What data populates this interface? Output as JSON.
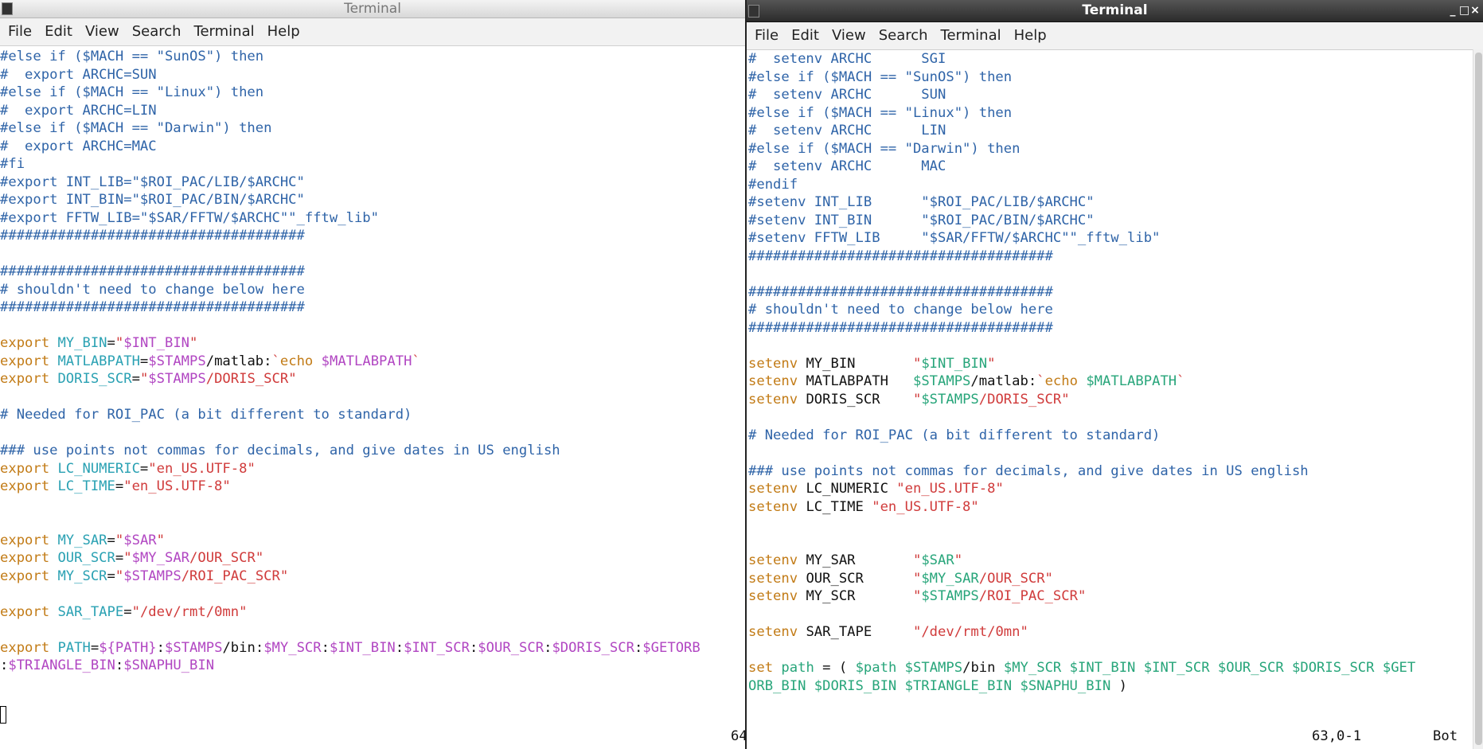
{
  "left": {
    "title": "Terminal",
    "menu": [
      "File",
      "Edit",
      "View",
      "Search",
      "Terminal",
      "Help"
    ],
    "status_right": "64"
  },
  "right": {
    "title": "Terminal",
    "menu": [
      "File",
      "Edit",
      "View",
      "Search",
      "Terminal",
      "Help"
    ],
    "status_pos": "63,0-1",
    "status_scroll": "Bot",
    "window_controls": [
      "minimize",
      "maximize",
      "close"
    ]
  },
  "left_lines": [
    [
      [
        "c",
        "#else if ($MACH == \"SunOS\") then"
      ]
    ],
    [
      [
        "c",
        "#  export ARCHC=SUN"
      ]
    ],
    [
      [
        "c",
        "#else if ($MACH == \"Linux\") then"
      ]
    ],
    [
      [
        "c",
        "#  export ARCHC=LIN"
      ]
    ],
    [
      [
        "c",
        "#else if ($MACH == \"Darwin\") then"
      ]
    ],
    [
      [
        "c",
        "#  export ARCHC=MAC"
      ]
    ],
    [
      [
        "c",
        "#fi"
      ]
    ],
    [
      [
        "c",
        "#export INT_LIB=\"$ROI_PAC/LIB/$ARCHC\""
      ]
    ],
    [
      [
        "c",
        "#export INT_BIN=\"$ROI_PAC/BIN/$ARCHC\""
      ]
    ],
    [
      [
        "c",
        "#export FFTW_LIB=\"$SAR/FFTW/$ARCHC\"\"_fftw_lib\""
      ]
    ],
    [
      [
        "c",
        "#####################################"
      ]
    ],
    [],
    [
      [
        "c",
        "#####################################"
      ]
    ],
    [
      [
        "c",
        "# shouldn't need to change below here"
      ]
    ],
    [
      [
        "c",
        "#####################################"
      ]
    ],
    [],
    [
      [
        "k",
        "export "
      ],
      [
        "v",
        "MY_BIN"
      ],
      [
        "p",
        "="
      ],
      [
        "s",
        "\""
      ],
      [
        "m",
        "$INT_BIN"
      ],
      [
        "s",
        "\""
      ]
    ],
    [
      [
        "k",
        "export "
      ],
      [
        "v",
        "MATLABPATH"
      ],
      [
        "p",
        "="
      ],
      [
        "m",
        "$STAMPS"
      ],
      [
        "p",
        "/matlab:"
      ],
      [
        "s",
        "`"
      ],
      [
        "k",
        "echo "
      ],
      [
        "m",
        "$MATLABPATH"
      ],
      [
        "s",
        "`"
      ]
    ],
    [
      [
        "k",
        "export "
      ],
      [
        "v",
        "DORIS_SCR"
      ],
      [
        "p",
        "="
      ],
      [
        "s",
        "\""
      ],
      [
        "m",
        "$STAMPS"
      ],
      [
        "s",
        "/DORIS_SCR\""
      ]
    ],
    [],
    [
      [
        "c",
        "# Needed for ROI_PAC (a bit different to standard)"
      ]
    ],
    [],
    [
      [
        "c",
        "### use points not commas for decimals, and give dates in US english"
      ]
    ],
    [
      [
        "k",
        "export "
      ],
      [
        "v",
        "LC_NUMERIC"
      ],
      [
        "p",
        "="
      ],
      [
        "s",
        "\"en_US.UTF-8\""
      ]
    ],
    [
      [
        "k",
        "export "
      ],
      [
        "v",
        "LC_TIME"
      ],
      [
        "p",
        "="
      ],
      [
        "s",
        "\"en_US.UTF-8\""
      ]
    ],
    [],
    [],
    [
      [
        "k",
        "export "
      ],
      [
        "v",
        "MY_SAR"
      ],
      [
        "p",
        "="
      ],
      [
        "s",
        "\""
      ],
      [
        "m",
        "$SAR"
      ],
      [
        "s",
        "\""
      ]
    ],
    [
      [
        "k",
        "export "
      ],
      [
        "v",
        "OUR_SCR"
      ],
      [
        "p",
        "="
      ],
      [
        "s",
        "\""
      ],
      [
        "m",
        "$MY_SAR"
      ],
      [
        "s",
        "/OUR_SCR\""
      ]
    ],
    [
      [
        "k",
        "export "
      ],
      [
        "v",
        "MY_SCR"
      ],
      [
        "p",
        "="
      ],
      [
        "s",
        "\""
      ],
      [
        "m",
        "$STAMPS"
      ],
      [
        "s",
        "/ROI_PAC_SCR\""
      ]
    ],
    [],
    [
      [
        "k",
        "export "
      ],
      [
        "v",
        "SAR_TAPE"
      ],
      [
        "p",
        "="
      ],
      [
        "s",
        "\"/dev/rmt/0mn\""
      ]
    ],
    [],
    [
      [
        "k",
        "export "
      ],
      [
        "v",
        "PATH"
      ],
      [
        "p",
        "="
      ],
      [
        "m",
        "${PATH}"
      ],
      [
        "p",
        ":"
      ],
      [
        "m",
        "$STAMPS"
      ],
      [
        "p",
        "/bin:"
      ],
      [
        "m",
        "$MY_SCR"
      ],
      [
        "p",
        ":"
      ],
      [
        "m",
        "$INT_BIN"
      ],
      [
        "p",
        ":"
      ],
      [
        "m",
        "$INT_SCR"
      ],
      [
        "p",
        ":"
      ],
      [
        "m",
        "$OUR_SCR"
      ],
      [
        "p",
        ":"
      ],
      [
        "m",
        "$DORIS_SCR"
      ],
      [
        "p",
        ":"
      ],
      [
        "m",
        "$GETORB"
      ]
    ],
    [
      [
        "p",
        ":"
      ],
      [
        "m",
        "$TRIANGLE_BIN"
      ],
      [
        "p",
        ":"
      ],
      [
        "m",
        "$SNAPHU_BIN"
      ]
    ]
  ],
  "right_lines": [
    [
      [
        "c",
        "#  setenv ARCHC      SGI"
      ]
    ],
    [
      [
        "c",
        "#else if ($MACH == \"SunOS\") then"
      ]
    ],
    [
      [
        "c",
        "#  setenv ARCHC      SUN"
      ]
    ],
    [
      [
        "c",
        "#else if ($MACH == \"Linux\") then"
      ]
    ],
    [
      [
        "c",
        "#  setenv ARCHC      LIN"
      ]
    ],
    [
      [
        "c",
        "#else if ($MACH == \"Darwin\") then"
      ]
    ],
    [
      [
        "c",
        "#  setenv ARCHC      MAC"
      ]
    ],
    [
      [
        "c",
        "#endif"
      ]
    ],
    [
      [
        "c",
        "#setenv INT_LIB      \"$ROI_PAC/LIB/$ARCHC\""
      ]
    ],
    [
      [
        "c",
        "#setenv INT_BIN      \"$ROI_PAC/BIN/$ARCHC\""
      ]
    ],
    [
      [
        "c",
        "#setenv FFTW_LIB     \"$SAR/FFTW/$ARCHC\"\"_fftw_lib\""
      ]
    ],
    [
      [
        "c",
        "#####################################"
      ]
    ],
    [],
    [
      [
        "c",
        "#####################################"
      ]
    ],
    [
      [
        "c",
        "# shouldn't need to change below here"
      ]
    ],
    [
      [
        "c",
        "#####################################"
      ]
    ],
    [],
    [
      [
        "k",
        "setenv "
      ],
      [
        "p",
        "MY_BIN       "
      ],
      [
        "s",
        "\""
      ],
      [
        "g",
        "$INT_BIN"
      ],
      [
        "s",
        "\""
      ]
    ],
    [
      [
        "k",
        "setenv "
      ],
      [
        "p",
        "MATLABPATH   "
      ],
      [
        "g",
        "$STAMPS"
      ],
      [
        "p",
        "/matlab:"
      ],
      [
        "s",
        "`"
      ],
      [
        "k",
        "echo "
      ],
      [
        "g",
        "$MATLABPATH"
      ],
      [
        "s",
        "`"
      ]
    ],
    [
      [
        "k",
        "setenv "
      ],
      [
        "p",
        "DORIS_SCR    "
      ],
      [
        "s",
        "\""
      ],
      [
        "g",
        "$STAMPS"
      ],
      [
        "s",
        "/DORIS_SCR\""
      ]
    ],
    [],
    [
      [
        "c",
        "# Needed for ROI_PAC (a bit different to standard)"
      ]
    ],
    [],
    [
      [
        "c",
        "### use points not commas for decimals, and give dates in US english"
      ]
    ],
    [
      [
        "k",
        "setenv "
      ],
      [
        "p",
        "LC_NUMERIC "
      ],
      [
        "s",
        "\"en_US.UTF-8\""
      ]
    ],
    [
      [
        "k",
        "setenv "
      ],
      [
        "p",
        "LC_TIME "
      ],
      [
        "s",
        "\"en_US.UTF-8\""
      ]
    ],
    [],
    [],
    [
      [
        "k",
        "setenv "
      ],
      [
        "p",
        "MY_SAR       "
      ],
      [
        "s",
        "\""
      ],
      [
        "g",
        "$SAR"
      ],
      [
        "s",
        "\""
      ]
    ],
    [
      [
        "k",
        "setenv "
      ],
      [
        "p",
        "OUR_SCR      "
      ],
      [
        "s",
        "\""
      ],
      [
        "g",
        "$MY_SAR"
      ],
      [
        "s",
        "/OUR_SCR\""
      ]
    ],
    [
      [
        "k",
        "setenv "
      ],
      [
        "p",
        "MY_SCR       "
      ],
      [
        "s",
        "\""
      ],
      [
        "g",
        "$STAMPS"
      ],
      [
        "s",
        "/ROI_PAC_SCR\""
      ]
    ],
    [],
    [
      [
        "k",
        "setenv "
      ],
      [
        "p",
        "SAR_TAPE     "
      ],
      [
        "s",
        "\"/dev/rmt/0mn\""
      ]
    ],
    [],
    [
      [
        "k",
        "set "
      ],
      [
        "g",
        "path"
      ],
      [
        "p",
        " = ( "
      ],
      [
        "g",
        "$path $STAMPS"
      ],
      [
        "p",
        "/bin "
      ],
      [
        "g",
        "$MY_SCR $INT_BIN $INT_SCR $OUR_SCR $DORIS_SCR $GET"
      ]
    ],
    [
      [
        "g",
        "ORB_BIN $DORIS_BIN $TRIANGLE_BIN $SNAPHU_BIN"
      ],
      [
        "p",
        " )"
      ]
    ]
  ]
}
